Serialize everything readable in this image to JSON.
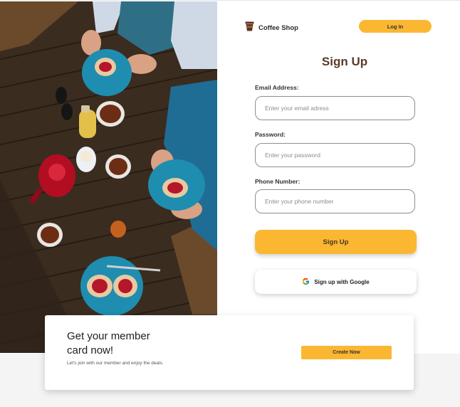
{
  "header": {
    "brand_name": "Coffee Shop",
    "login_label": "Log In"
  },
  "form": {
    "title": "Sign Up",
    "email": {
      "label": "Email Address:",
      "placeholder": "Enter your email adress",
      "value": ""
    },
    "password": {
      "label": "Password:",
      "placeholder": "Enter your password",
      "value": ""
    },
    "phone": {
      "label": "Phone Number:",
      "placeholder": "Enter your phone number",
      "value": ""
    },
    "submit_label": "Sign Up",
    "google_label": "Sign up with Google"
  },
  "member_card": {
    "heading": "Get your member card now!",
    "text": "Let's join with our member and enjoy the deals.",
    "cta_label": "Create Now"
  },
  "icons": {
    "brand": "coffee-cup-icon",
    "google": "google-logo-icon"
  },
  "colors": {
    "accent": "#fbb732",
    "title": "#5a3b2a",
    "strip": "#f4f4f4"
  }
}
